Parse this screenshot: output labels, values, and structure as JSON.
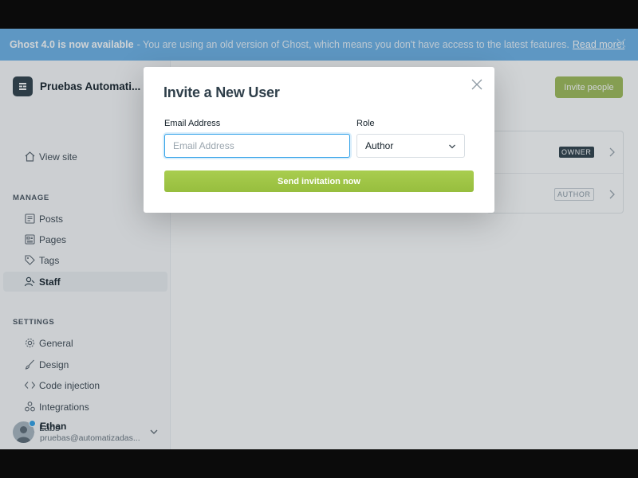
{
  "banner": {
    "title": "Ghost 4.0 is now available",
    "message": "- You are using an old version of Ghost, which means you don't have access to the latest features.",
    "link": "Read more!"
  },
  "sidebar": {
    "site_name": "Pruebas Automati...",
    "view_site": "View site",
    "manage_label": "MANAGE",
    "manage_items": [
      {
        "label": "Posts"
      },
      {
        "label": "Pages"
      },
      {
        "label": "Tags"
      },
      {
        "label": "Staff",
        "active": true
      }
    ],
    "settings_label": "SETTINGS",
    "settings_items": [
      {
        "label": "General"
      },
      {
        "label": "Design"
      },
      {
        "label": "Code injection"
      },
      {
        "label": "Integrations"
      },
      {
        "label": "Labs"
      }
    ],
    "user": {
      "name": "Ethan",
      "email": "pruebas@automatizadas..."
    }
  },
  "main": {
    "invite_button": "Invite people",
    "staff": [
      {
        "role_badge": "OWNER"
      },
      {
        "role_badge": "AUTHOR"
      }
    ]
  },
  "modal": {
    "title": "Invite a New User",
    "email_label": "Email Address",
    "email_placeholder": "Email Address",
    "email_value": "",
    "role_label": "Role",
    "role_selected": "Author",
    "submit": "Send invitation now"
  },
  "colors": {
    "banner": "#6db2e8",
    "accent_green": "#9fbb58",
    "focus_blue": "#30a1e8"
  }
}
